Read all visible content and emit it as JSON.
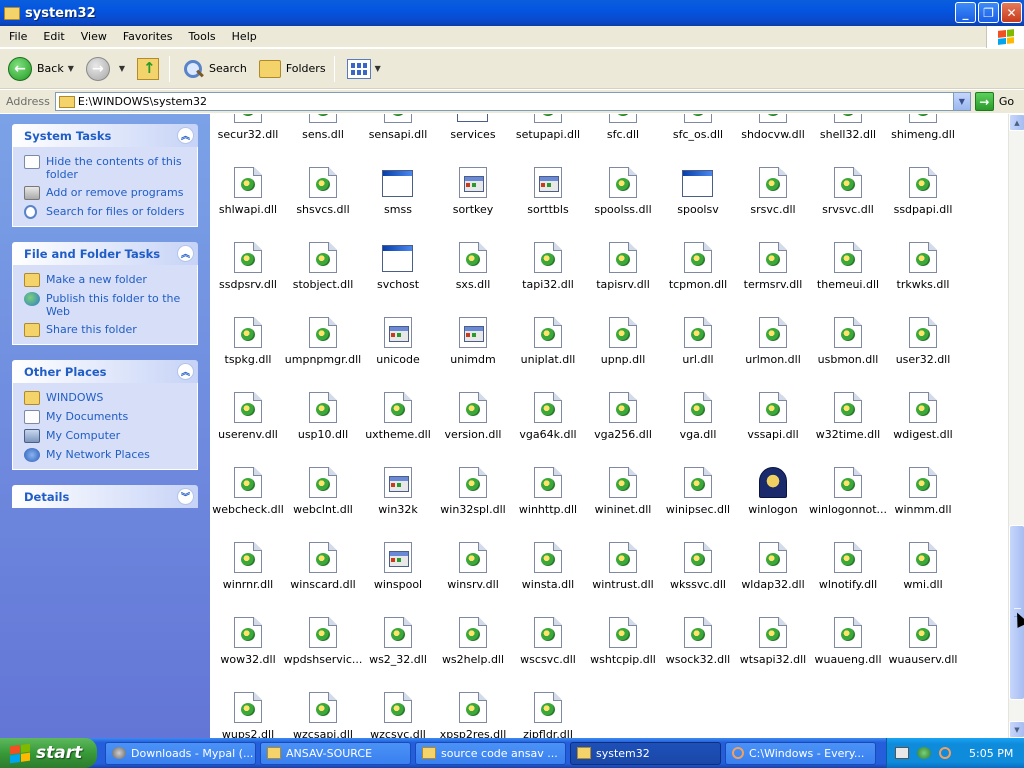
{
  "window": {
    "title": "system32",
    "controls": {
      "minimize": "_",
      "maximize": "❐",
      "close": "✕"
    }
  },
  "menu": [
    "File",
    "Edit",
    "View",
    "Favorites",
    "Tools",
    "Help"
  ],
  "toolbar": {
    "back": "Back",
    "search": "Search",
    "folders": "Folders"
  },
  "address": {
    "label": "Address",
    "value": "E:\\WINDOWS\\system32",
    "go": "Go"
  },
  "taskpane": {
    "system_tasks": {
      "title": "System Tasks",
      "items": [
        {
          "label": "Hide the contents of this folder",
          "icon": "document-icon"
        },
        {
          "label": "Add or remove programs",
          "icon": "programs-icon"
        },
        {
          "label": "Search for files or folders",
          "icon": "search-icon"
        }
      ]
    },
    "file_folder_tasks": {
      "title": "File and Folder Tasks",
      "items": [
        {
          "label": "Make a new folder",
          "icon": "folder-icon"
        },
        {
          "label": "Publish this folder to the Web",
          "icon": "globe-icon"
        },
        {
          "label": "Share this folder",
          "icon": "folder-icon"
        }
      ]
    },
    "other_places": {
      "title": "Other Places",
      "items": [
        {
          "label": "WINDOWS",
          "icon": "folder-icon"
        },
        {
          "label": "My Documents",
          "icon": "documents-icon"
        },
        {
          "label": "My Computer",
          "icon": "computer-icon"
        },
        {
          "label": "My Network Places",
          "icon": "network-icon"
        }
      ]
    },
    "details": {
      "title": "Details"
    }
  },
  "files": [
    [
      "secur32.dll",
      "sens.dll",
      "sensapi.dll",
      "services",
      "setupapi.dll",
      "sfc.dll",
      "sfc_os.dll",
      "shdocvw.dll",
      "shell32.dll",
      "shimeng.dll"
    ],
    [
      "shlwapi.dll",
      "shsvcs.dll",
      "smss",
      "sortkey",
      "sorttbls",
      "spoolss.dll",
      "spoolsv",
      "srsvc.dll",
      "srvsvc.dll",
      "ssdpapi.dll"
    ],
    [
      "ssdpsrv.dll",
      "stobject.dll",
      "svchost",
      "sxs.dll",
      "tapi32.dll",
      "tapisrv.dll",
      "tcpmon.dll",
      "termsrv.dll",
      "themeui.dll",
      "trkwks.dll"
    ],
    [
      "tspkg.dll",
      "umpnpmgr.dll",
      "unicode",
      "unimdm",
      "uniplat.dll",
      "upnp.dll",
      "url.dll",
      "urlmon.dll",
      "usbmon.dll",
      "user32.dll"
    ],
    [
      "userenv.dll",
      "usp10.dll",
      "uxtheme.dll",
      "version.dll",
      "vga64k.dll",
      "vga256.dll",
      "vga.dll",
      "vssapi.dll",
      "w32time.dll",
      "wdigest.dll"
    ],
    [
      "webcheck.dll",
      "webclnt.dll",
      "win32k",
      "win32spl.dll",
      "winhttp.dll",
      "wininet.dll",
      "winipsec.dll",
      "winlogon",
      "winlogonnot...",
      "winmm.dll"
    ],
    [
      "winrnr.dll",
      "winscard.dll",
      "winspool",
      "winsrv.dll",
      "winsta.dll",
      "wintrust.dll",
      "wkssvc.dll",
      "wldap32.dll",
      "wlnotify.dll",
      "wmi.dll"
    ],
    [
      "wow32.dll",
      "wpdshservic...",
      "ws2_32.dll",
      "ws2help.dll",
      "wscsvc.dll",
      "wshtcpip.dll",
      "wsock32.dll",
      "wtsapi32.dll",
      "wuaueng.dll",
      "wuauserv.dll"
    ],
    [
      "wups2.dll",
      "wzcsapi.dll",
      "wzcsvc.dll",
      "xpsp2res.dll",
      "zipfldr.dll"
    ]
  ],
  "file_types": {
    "services": "exe",
    "smss": "exe",
    "spoolsv": "exe",
    "svchost": "exe",
    "sortkey": "sys",
    "sorttbls": "sys",
    "unicode": "sys",
    "unimdm": "sys",
    "win32k": "sys",
    "winspool": "sys",
    "winlogon": "winlogon"
  },
  "scrollbar": {
    "position_fraction": 0.95
  },
  "taskbar": {
    "start": "start",
    "tasks": [
      {
        "label": "Downloads - Mypal (...",
        "icon": "download-icon"
      },
      {
        "label": "ANSAV-SOURCE",
        "icon": "folder-icon"
      },
      {
        "label": "source code ansav ...",
        "icon": "folder-icon"
      },
      {
        "label": "system32",
        "icon": "folder-icon",
        "active": true
      },
      {
        "label": "C:\\Windows - Every...",
        "icon": "search-icon"
      }
    ],
    "clock": "5:05 PM"
  }
}
